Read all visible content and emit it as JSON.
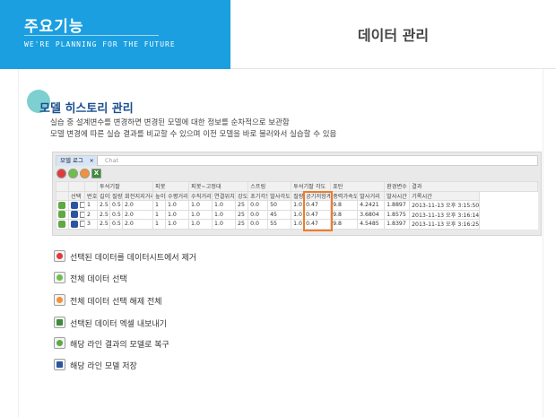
{
  "header": {
    "brand_title": "주요기능",
    "brand_tagline": "WE'RE PLANNING FOR THE FUTURE",
    "page_title": "데이터 관리"
  },
  "section": {
    "title": "모델 히스토리 관리",
    "desc_line1": "실습 중 설계변수를 변경하면 변경된 모델에 대한 정보를 순차적으로 보관함",
    "desc_line2": "모델 변경에 따른 실습 결과를 비교할 수 있으며 이전 모델을 바로 불러와서 실습할 수 있음"
  },
  "grid": {
    "tabs": [
      {
        "label": "모델 로그",
        "close": "×"
      },
      {
        "label": "Chat"
      }
    ],
    "group_headers": [
      "투석기팔",
      "피봇",
      "피봇~고정대",
      "스프링",
      "투석기팔 각도",
      "포탄",
      "환경변수",
      "결과"
    ],
    "column_headers": [
      "선택",
      "번호",
      "길이",
      "질량",
      "회전지지거리",
      "높이",
      "수평거리",
      "수직거리",
      "연결위치",
      "강도",
      "초기각도",
      "발사각도",
      "질량",
      "공기저항계수",
      "중력가속도",
      "발사거리",
      "발사시간",
      "기록시간"
    ],
    "rows": [
      [
        "1",
        "2.5",
        "0.5",
        "2.0",
        "1",
        "1.0",
        "1.0",
        "1.0",
        "25",
        "0.0",
        "50",
        "1.0",
        "0.47",
        "9.8",
        "4.2421",
        "1.8897",
        "2013-11-13 오후 3:15:50"
      ],
      [
        "2",
        "2.5",
        "0.5",
        "2.0",
        "1",
        "1.0",
        "1.0",
        "1.0",
        "25",
        "0.0",
        "45",
        "1.0",
        "0.47",
        "9.8",
        "3.6804",
        "1.8575",
        "2013-11-13 오후 3:16:14"
      ],
      [
        "3",
        "2.5",
        "0.5",
        "2.0",
        "1",
        "1.0",
        "1.0",
        "1.0",
        "25",
        "0.0",
        "55",
        "1.0",
        "0.47",
        "9.8",
        "4.5485",
        "1.8397",
        "2013-11-13 오후 3:16:25"
      ]
    ]
  },
  "legend": [
    {
      "icon": "remove-icon",
      "color": "#e03a3a",
      "text": "선택된 데이터를 데이터시트에서 제거"
    },
    {
      "icon": "select-all-icon",
      "color": "#6cc04a",
      "text": "전체 데이터 선택"
    },
    {
      "icon": "deselect-all-icon",
      "color": "#f2913a",
      "text": "전체 데이터 선택 해제 전체"
    },
    {
      "icon": "excel-export-icon",
      "color": "#3b8c3b",
      "text": "선택된 데이터 엑셀 내보내기"
    },
    {
      "icon": "restore-icon",
      "color": "#5fa843",
      "text": "해당 라인 결과의 모델로 복구"
    },
    {
      "icon": "save-icon",
      "color": "#2b55a0",
      "text": "해당 라인 모델 저장"
    }
  ],
  "colors": {
    "brand_bg": "#1b9fe0",
    "section_title": "#1a4e8e",
    "highlight_border": "#f07b2a"
  }
}
